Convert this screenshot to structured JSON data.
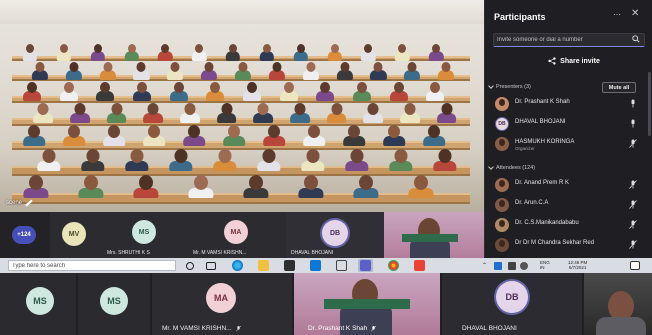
{
  "stage": {
    "label": "scene"
  },
  "panel": {
    "title": "Participants",
    "more": "⋯",
    "close": "✕",
    "invite_placeholder": "Invite someone or dial a number",
    "share_invite": "Share invite",
    "presenters_header": "Presenters (3)",
    "mute_all": "Mute all",
    "presenters": [
      {
        "initials": "",
        "name": "Dr. Prashant K Shah",
        "sub": "",
        "avatar_color": "#c48a6a",
        "photo": true
      },
      {
        "initials": "DB",
        "name": "DHAVAL BHOJANI",
        "sub": "",
        "avatar_color": "#e8d7e0",
        "photo": false
      },
      {
        "initials": "",
        "name": "HASMUKH KORINGA",
        "sub": "Organizer",
        "avatar_color": "#8a5f46",
        "photo": true
      }
    ],
    "attendees_header": "Attendees (124)",
    "attendees": [
      {
        "initials": "",
        "name": "Dr. Anand Prem R K",
        "avatar_color": "#9c6b52"
      },
      {
        "initials": "",
        "name": "Dr. Arun.C.A",
        "avatar_color": "#7f5a48"
      },
      {
        "initials": "",
        "name": "Dr. C.S.Manikandababu",
        "avatar_color": "#b08866"
      },
      {
        "initials": "",
        "name": "Dr Dr M Chandra Sekhar Red",
        "avatar_color": "#6d4b3a"
      }
    ]
  },
  "strip1": {
    "more_count": "+124",
    "tiles": [
      {
        "initials": "MV",
        "label": "",
        "bg": "#e8e3b8",
        "fg": "#4a4a2a"
      },
      {
        "initials": "MS",
        "label": "Mrs. SHRUTHI K S",
        "bg": "#cfe8df",
        "fg": "#2d5a4a"
      },
      {
        "initials": "MA",
        "label": "Mr. M VAMSI KRISHN...",
        "bg": "#f2d0d6",
        "fg": "#7a3040"
      },
      {
        "initials": "DB",
        "label": "DHAVAL BHOJANI",
        "bg": "#e5d5ea",
        "fg": "#4a2c5a"
      }
    ]
  },
  "taskbar": {
    "search_placeholder": "Type here to search",
    "lang": "ENG",
    "region": "IN",
    "time": "12:46 PM",
    "date": "6/7/2021"
  },
  "strip2": {
    "tiles": [
      {
        "initials": "MS",
        "label": "",
        "bg": "#cfe8df",
        "fg": "#2d5a4a"
      },
      {
        "initials": "MS",
        "label": "",
        "bg": "#cfe8df",
        "fg": "#2d5a4a"
      },
      {
        "initials": "MA",
        "label": "Mr. M VAMSI KRISHN...",
        "bg": "#f2d0d6",
        "fg": "#7a3040"
      },
      {
        "initials": "",
        "label": "Dr. Prashant K Shah",
        "bg": "",
        "fg": ""
      },
      {
        "initials": "DB",
        "label": "DHAVAL BHOJANI",
        "bg": "#e5d5ea",
        "fg": "#4a2c5a"
      },
      {
        "initials": "",
        "label": "",
        "bg": "",
        "fg": ""
      }
    ]
  },
  "colors": {
    "accent": "#6264a7",
    "panel_bg": "#1f1f23",
    "taskbar_bg": "#d9dce3"
  }
}
